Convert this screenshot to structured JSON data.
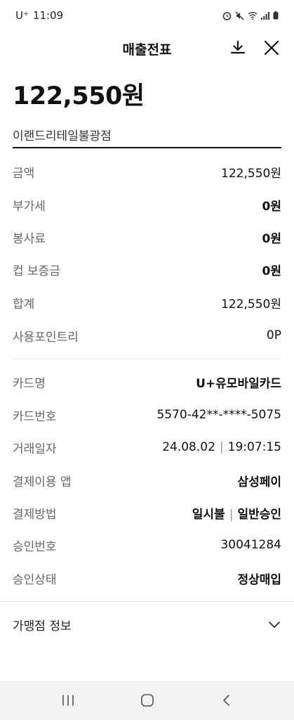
{
  "status_bar": {
    "carrier": "U⁺",
    "time": "11:09"
  },
  "header": {
    "title": "매출전표"
  },
  "summary": {
    "amount": "122,550원",
    "merchant": "이랜드리테일불광점"
  },
  "payment_rows": [
    {
      "label": "금액",
      "value": "122,550원"
    },
    {
      "label": "부가세",
      "value": "0원"
    },
    {
      "label": "봉사료",
      "value": "0원"
    },
    {
      "label": "컵 보증금",
      "value": "0원"
    },
    {
      "label": "합계",
      "value": "122,550원"
    },
    {
      "label": "사용포인트리",
      "value": "0P"
    }
  ],
  "card_rows": {
    "card_name": {
      "label": "카드명",
      "value": "U+유모바일카드"
    },
    "card_number": {
      "label": "카드번호",
      "value": "5570-42**-****-5075"
    },
    "transaction_date": {
      "label": "거래일자",
      "date": "24.08.02",
      "separator": "|",
      "time": "19:07:15"
    },
    "payment_app": {
      "label": "결제이용 앱",
      "value": "삼성페이"
    },
    "payment_method": {
      "label": "결제방법",
      "method": "일시불",
      "separator": "|",
      "approval_type": "일반승인"
    },
    "approval_number": {
      "label": "승인번호",
      "value": "30041284"
    },
    "approval_status": {
      "label": "승인상태",
      "value": "정상매입"
    }
  },
  "merchant_info": {
    "label": "가맹점 정보"
  },
  "icons": {
    "download": "download-icon",
    "close": "close-icon",
    "expand": "chevron-down-icon",
    "recent_apps": "recent-apps-icon",
    "home": "home-icon",
    "back": "back-icon"
  }
}
